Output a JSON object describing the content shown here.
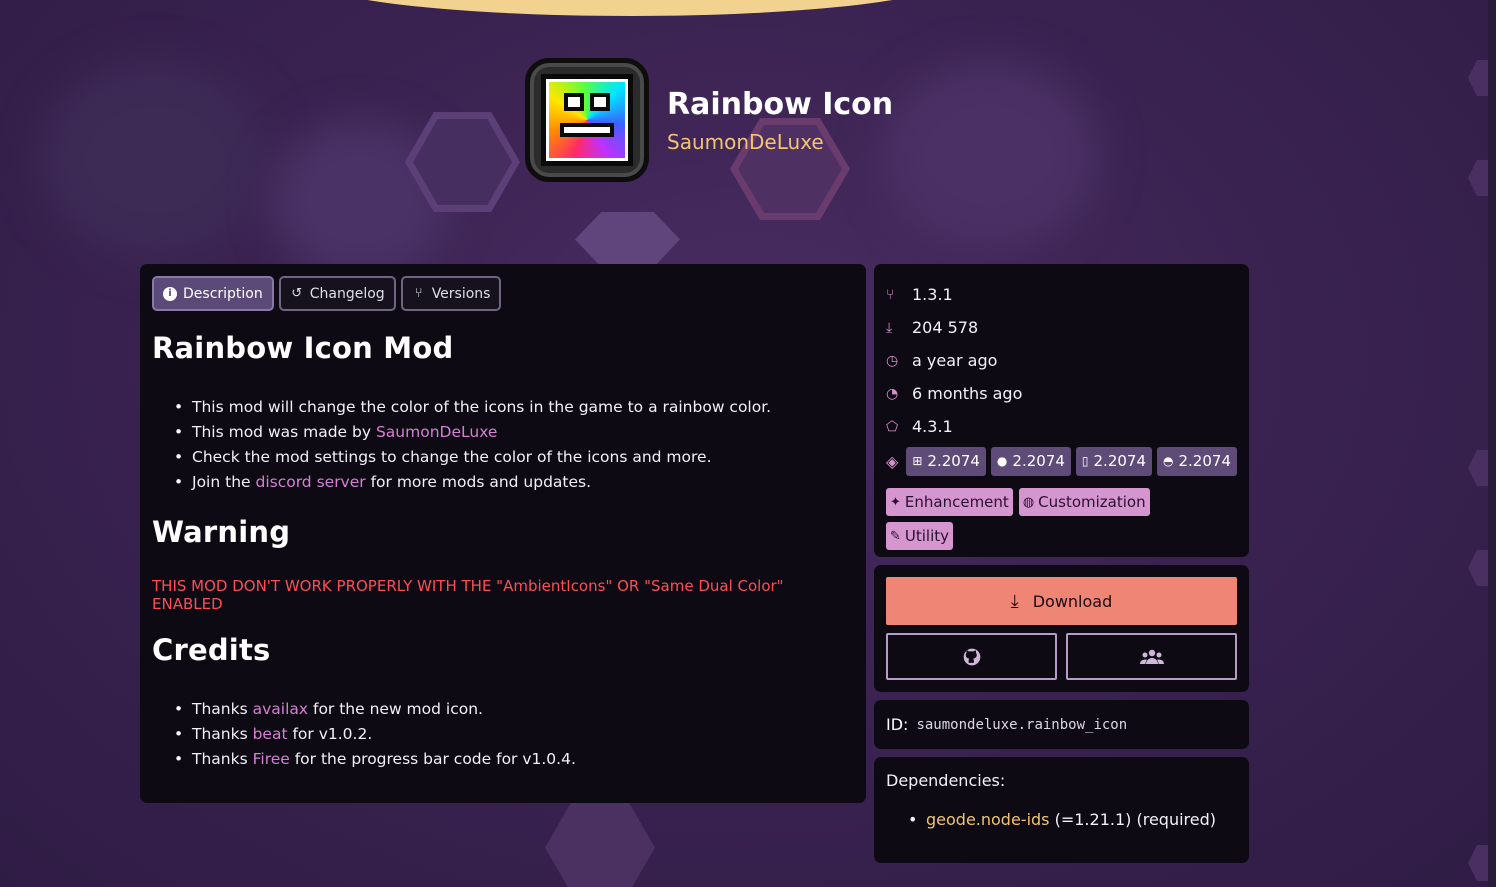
{
  "mod": {
    "title": "Rainbow Icon",
    "author": "SaumonDeLuxe"
  },
  "tabs": [
    {
      "label": "Description",
      "icon": "info-icon"
    },
    {
      "label": "Changelog",
      "icon": "history-icon"
    },
    {
      "label": "Versions",
      "icon": "branch-icon"
    }
  ],
  "description": {
    "heading": "Rainbow Icon Mod",
    "bullets": [
      {
        "pre": "This mod will change the color of the icons in the game to a rainbow color.",
        "link": "",
        "post": ""
      },
      {
        "pre": "This mod was made by ",
        "link": "SaumonDeLuxe",
        "post": ""
      },
      {
        "pre": "Check the mod settings to change the color of the icons and more.",
        "link": "",
        "post": ""
      },
      {
        "pre": "Join the ",
        "link": "discord server",
        "post": " for more mods and updates."
      }
    ],
    "warning_heading": "Warning",
    "warning_text": "THIS MOD DON'T WORK PROPERLY WITH THE \"AmbientIcons\" OR \"Same Dual Color\" ENABLED",
    "credits_heading": "Credits",
    "credits": [
      {
        "pre": "Thanks ",
        "link": "availax",
        "post": " for the new mod icon."
      },
      {
        "pre": "Thanks ",
        "link": "beat",
        "post": " for v1.0.2."
      },
      {
        "pre": "Thanks ",
        "link": "Firee",
        "post": " for the progress bar code for v1.0.4."
      }
    ]
  },
  "info": {
    "version": "1.3.1",
    "downloads": "204 578",
    "created": "a year ago",
    "updated": "6 months ago",
    "geode_version": "4.3.1",
    "platforms": [
      {
        "icon": "windows-icon",
        "version": "2.2074"
      },
      {
        "icon": "apple-icon",
        "version": "2.2074"
      },
      {
        "icon": "phone-icon",
        "version": "2.2074"
      },
      {
        "icon": "android-icon",
        "version": "2.2074"
      }
    ],
    "tags": [
      {
        "icon": "wand-icon",
        "label": "Enhancement"
      },
      {
        "icon": "palette-icon",
        "label": "Customization"
      },
      {
        "icon": "wrench-icon",
        "label": "Utility"
      }
    ]
  },
  "actions": {
    "download_label": "Download"
  },
  "mod_id": {
    "label": "ID:",
    "value": "saumondeluxe.rainbow_icon"
  },
  "dependencies": {
    "title": "Dependencies:",
    "items": [
      {
        "link": "geode.node-ids",
        "detail": " (=1.21.1) (required)"
      }
    ]
  },
  "colors": {
    "accent_download": "#ef8575",
    "link_pink": "#d77fd4",
    "author_gold": "#f2c46e",
    "warning_red": "#ff4d57",
    "tag_bg": "#d596cf",
    "platform_bg": "#5e4b78"
  }
}
